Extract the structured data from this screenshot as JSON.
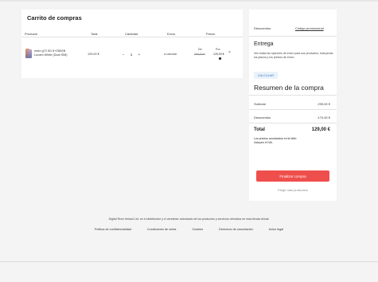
{
  "cart": {
    "title": "Carrito de compras",
    "columns": {
      "product": "Producto",
      "total": "Total",
      "quantity": "Cantidad",
      "shipping": "Envío",
      "price": "Precio"
    },
    "item": {
      "name_line1": "moto g72 5G 8+256GB",
      "name_line2": "Lunam White (Dual SIM)",
      "total": "129,00 €",
      "quantity": "1",
      "minus": "−",
      "plus": "+",
      "shipping": "a calcular",
      "price_old_label": "De:",
      "price_old": "299,00 €",
      "price_new_label": "Por:",
      "price_new": "129,00 €",
      "remove": "×"
    }
  },
  "summary": {
    "discounts_label": "Descuentos",
    "promo_link": "Código promocional",
    "delivery_title": "Entrega",
    "delivery_text": "Ves todas las opciones de envío para sus productos, incluyendo los plazos y los precios de envío.",
    "calculate_button": "CALCULAR",
    "summary_title": "Resumen de la compra",
    "subtotal_label": "Subtotal",
    "subtotal_value": "299,00 €",
    "discount_label": "Descuentos",
    "discount_value": "-170,00 €",
    "total_label": "Total",
    "total_value": "129,00 €",
    "vat_note": "Los precios anunciados en la Web incluyen el IVA.",
    "finalize_button": "Finalizar compra",
    "more_products_link": "Elegir más productos"
  },
  "footer": {
    "text": "Digital River Ireland Ltd. es el distribuidor y el vendedor autorizado de los productos y servicios ofrecidos en esta tienda virtual.",
    "links": [
      "Política de confidencialidad",
      "Condiciones de venta",
      "Cookies",
      "Derechos de cancelación",
      "Aviso legal"
    ]
  },
  "colors": {
    "accent": "#ef4f4c",
    "link_blue": "#3b7ac2",
    "background": "#f4f4f4"
  }
}
